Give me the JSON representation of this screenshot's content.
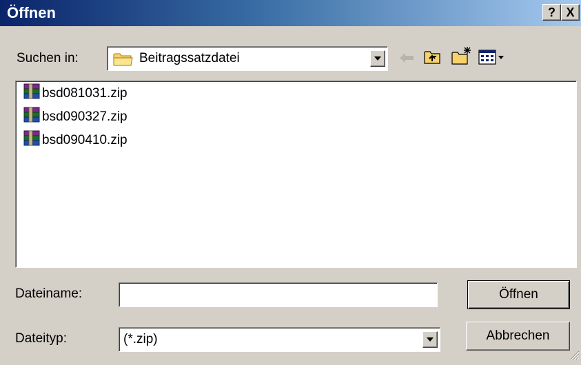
{
  "window": {
    "title": "Öffnen",
    "help_label": "?",
    "close_label": "X"
  },
  "lookin": {
    "label": "Suchen in:",
    "folder": "Beitragssatzdatei"
  },
  "toolbar": {
    "icons": [
      "back-arrow-icon",
      "up-folder-icon",
      "new-folder-icon",
      "view-menu-icon"
    ]
  },
  "files": [
    {
      "name": "bsd081031.zip",
      "icon": "winrar-archive-icon"
    },
    {
      "name": "bsd090327.zip",
      "icon": "winrar-archive-icon"
    },
    {
      "name": "bsd090410.zip",
      "icon": "winrar-archive-icon"
    }
  ],
  "filename": {
    "label": "Dateiname:",
    "value": ""
  },
  "filetype": {
    "label": "Dateityp:",
    "value": "(*.zip)"
  },
  "buttons": {
    "open": "Öffnen",
    "cancel": "Abbrechen"
  }
}
